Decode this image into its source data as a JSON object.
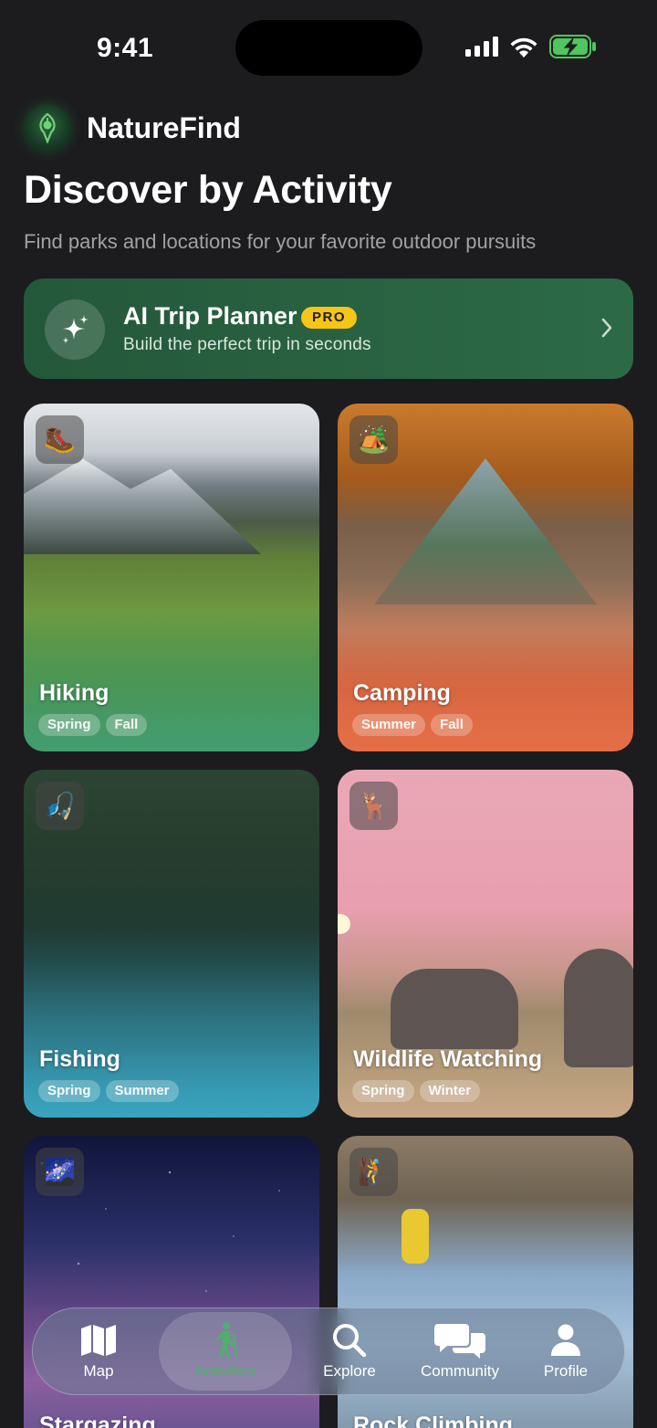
{
  "status": {
    "time": "9:41"
  },
  "brand": {
    "name": "NatureFind"
  },
  "page": {
    "title": "Discover by Activity",
    "subtitle": "Find parks and locations for your favorite outdoor pursuits"
  },
  "ai_banner": {
    "title": "AI Trip Planner",
    "badge": "PRO",
    "subtitle": "Build the perfect trip in seconds"
  },
  "activities": [
    {
      "name": "Hiking",
      "emoji": "🥾",
      "tags": [
        "Spring",
        "Fall"
      ]
    },
    {
      "name": "Camping",
      "emoji": "🏕️",
      "tags": [
        "Summer",
        "Fall"
      ]
    },
    {
      "name": "Fishing",
      "emoji": "🎣",
      "tags": [
        "Spring",
        "Summer"
      ]
    },
    {
      "name": "Wildlife Watching",
      "emoji": "🦌",
      "tags": [
        "Spring",
        "Winter"
      ]
    },
    {
      "name": "Stargazing",
      "emoji": "🌌",
      "tags": []
    },
    {
      "name": "Rock Climbing",
      "emoji": "🧗",
      "tags": []
    }
  ],
  "tab_bar": {
    "tabs": [
      {
        "label": "Map",
        "icon": "map-icon"
      },
      {
        "label": "Activities",
        "icon": "hiker-icon",
        "active": true
      },
      {
        "label": "Explore",
        "icon": "search-icon"
      },
      {
        "label": "Community",
        "icon": "chat-bubbles-icon"
      },
      {
        "label": "Profile",
        "icon": "person-icon"
      }
    ]
  },
  "colors": {
    "background": "#1c1c1e",
    "accent_green": "#4fb06c",
    "banner_green": "#2c6a47",
    "pro_yellow": "#f5c518"
  }
}
